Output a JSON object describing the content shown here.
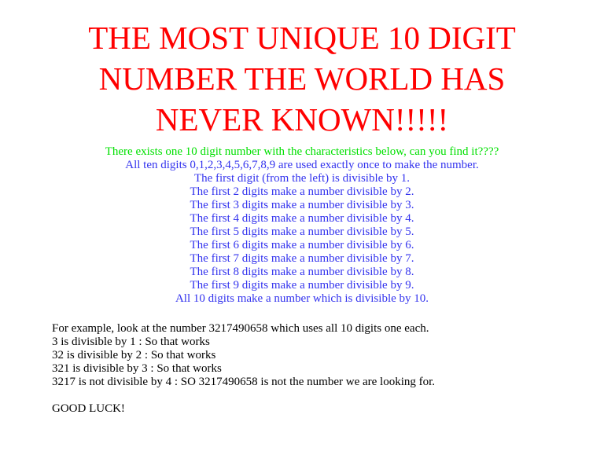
{
  "colors": {
    "title": "#ff0000",
    "intro": "#00e000",
    "rules": "#3333ee",
    "body": "#000000",
    "background": "#ffffff"
  },
  "title": {
    "line1": "THE MOST UNIQUE 10 DIGIT",
    "line2": "NUMBER THE WORLD HAS",
    "line3": "NEVER KNOWN!!!!!"
  },
  "intro": {
    "text": "There exists one 10 digit number with the characteristics below, can you find it????"
  },
  "rules": [
    {
      "text": "All ten digits 0,1,2,3,4,5,6,7,8,9 are used exactly once to make the number."
    },
    {
      "text": "The first digit (from the left) is divisible by 1."
    },
    {
      "text": "The first 2 digits make a number divisible by 2."
    },
    {
      "text": "The first 3 digits make a number divisible by 3."
    },
    {
      "text": "The first 4 digits make a number divisible by 4."
    },
    {
      "text": "The first 5 digits make a number divisible by 5."
    },
    {
      "text": "The first 6 digits make a number divisible by 6."
    },
    {
      "text": "The first 7 digits make a number divisible by 7."
    },
    {
      "text": "The first 8 digits make a number divisible by 8."
    },
    {
      "text": "The first 9 digits make a number divisible by 9."
    },
    {
      "text": "All 10 digits make a number which is divisible by 10."
    }
  ],
  "example": {
    "intro": "For example, look at the number 3217490658 which uses all 10 digits one each.",
    "steps": [
      {
        "text": "3 is divisible by 1 : So that works"
      },
      {
        "text": "32 is divisible by 2 : So that works"
      },
      {
        "text": "321 is divisible by 3 : So that works"
      },
      {
        "text": "3217 is not divisible by 4 : SO 3217490658 is not the number we are looking for."
      }
    ],
    "closing": "GOOD LUCK!"
  }
}
